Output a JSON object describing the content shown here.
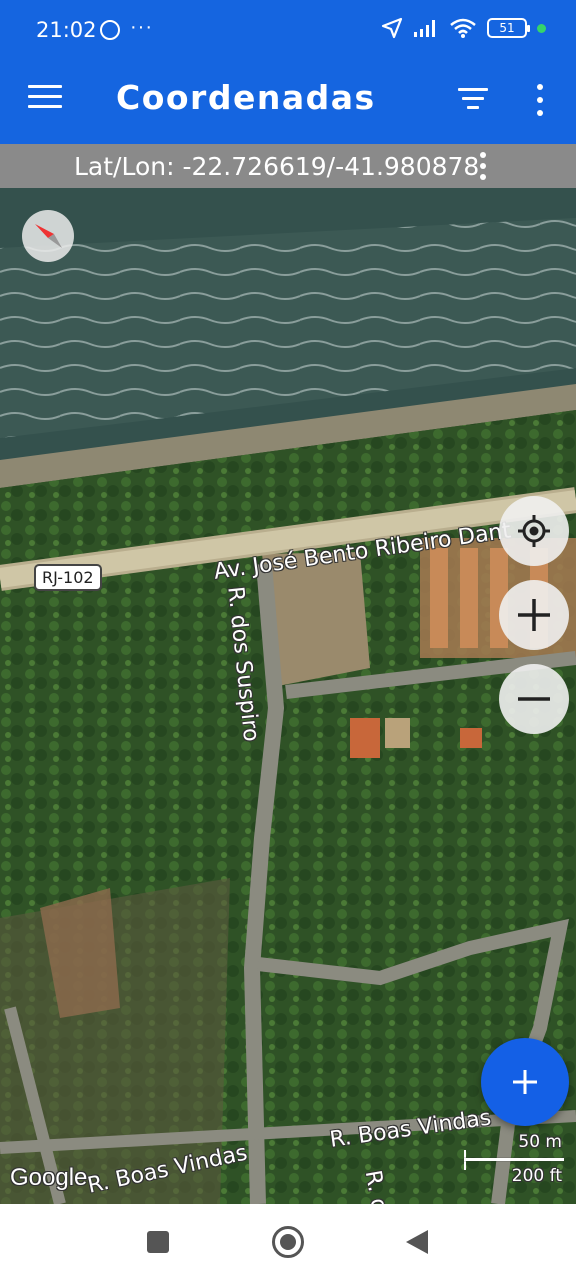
{
  "status_bar": {
    "time": "21:02",
    "more": "···",
    "battery": "51",
    "icons": [
      "whatsapp-icon",
      "location-arrow-icon",
      "signal-icon",
      "wifi-icon",
      "battery-icon",
      "charging-dot-icon"
    ]
  },
  "app_bar": {
    "title": "Coordenadas",
    "icons": [
      "menu-icon",
      "filter-icon",
      "more-vert-icon"
    ],
    "color": "#1565e0"
  },
  "coords_bar": {
    "text": "Lat/Lon: -22.726619/-41.980878"
  },
  "map": {
    "roads": {
      "main": "Av. José Bento Ribeiro Dant",
      "route": "RJ-102",
      "suspiro": "R. dos Suspiro",
      "boas_vindas_right": "R. Boas Vindas",
      "boas_vindas_left": "R. Boas Vindas",
      "r_d": "R. d"
    },
    "google": "Google",
    "scale": {
      "meters": "50 m",
      "feet": "200 ft"
    },
    "controls": [
      "compass-icon",
      "my-location-icon",
      "zoom-in-icon",
      "zoom-out-icon",
      "add-icon"
    ],
    "fab_color": "#1460e6"
  },
  "nav_bar": {
    "icons": [
      "recent-apps-icon",
      "home-icon",
      "back-icon"
    ]
  }
}
